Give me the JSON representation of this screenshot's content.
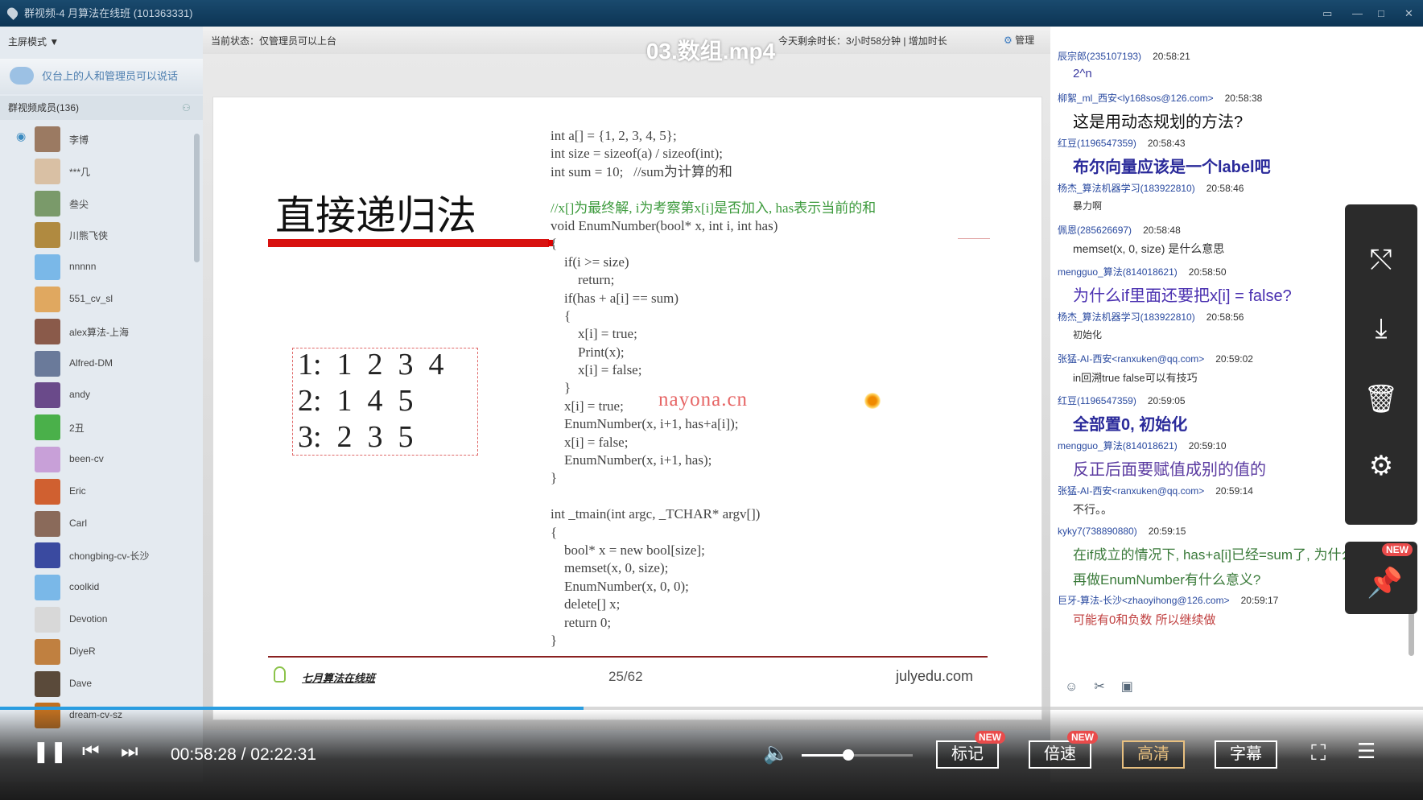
{
  "window": {
    "title": "群视频-4 月算法在线班 (101363331)",
    "controls": [
      "▭",
      "—",
      "□",
      "✕"
    ]
  },
  "sidebar": {
    "mode_label": "主屏模式 ▼",
    "tip": "仅台上的人和管理员可以说话",
    "members_header": "群视频成员(136)",
    "members": [
      {
        "name": "李博",
        "color": "#9b7a62"
      },
      {
        "name": "***几",
        "color": "#d9c0a4"
      },
      {
        "name": "叁尖",
        "color": "#7a9a6a"
      },
      {
        "name": "川熊飞侠",
        "color": "#b08a40"
      },
      {
        "name": "nnnnn",
        "color": "#7ab8e8"
      },
      {
        "name": "551_cv_sl",
        "color": "#e0a860"
      },
      {
        "name": "alex算法-上海",
        "color": "#8a5a4a"
      },
      {
        "name": "Alfred-DM",
        "color": "#6a7a9a"
      },
      {
        "name": "andy",
        "color": "#6a4a8a"
      },
      {
        "name": "2丑",
        "color": "#4ab04a"
      },
      {
        "name": "been-cv",
        "color": "#c8a0d8"
      },
      {
        "name": "Eric",
        "color": "#d06030"
      },
      {
        "name": "Carl",
        "color": "#8a6a5a"
      },
      {
        "name": "chongbing-cv-长沙",
        "color": "#3a4aa0"
      },
      {
        "name": "coolkid",
        "color": "#7ab8e8"
      },
      {
        "name": "Devotion",
        "color": "#d8d8d8"
      },
      {
        "name": "DiyeR",
        "color": "#c08040"
      },
      {
        "name": "Dave",
        "color": "#5a4a3a"
      },
      {
        "name": "dream-cv-sz",
        "color": "#c07020"
      }
    ]
  },
  "status_bar": {
    "left": "当前状态：仅管理员可以上台",
    "right": "今天剩余时长：3小时58分钟 | 增加时长",
    "manage": "管理"
  },
  "video": {
    "title": "03.数组.mp4",
    "current_time": "00:58:28",
    "total_time": "02:22:31",
    "progress_percent": 41,
    "volume_percent": 42,
    "buttons": {
      "mark": "标记",
      "speed": "倍速",
      "hd": "高清",
      "subtitle": "字幕",
      "new_badge": "NEW"
    },
    "accent": "#2a9de0",
    "hd_color": "#e8c080"
  },
  "slide": {
    "title": "直接递归法",
    "solutions": [
      "1:  1  2  3  4",
      "2:  1  4  5",
      "3:  2  3  5"
    ],
    "code": [
      {
        "t": "int a[] = {1, 2, 3, 4, 5};",
        "c": ""
      },
      {
        "t": "int size = sizeof(a) / sizeof(int);",
        "c": ""
      },
      {
        "t": "int sum = 10;   //sum为计算的和",
        "c": ""
      },
      {
        "t": "",
        "c": ""
      },
      {
        "t": "//x[]为最终解, i为考察第x[i]是否加入, has表示当前的和",
        "c": "cmt"
      },
      {
        "t": "void EnumNumber(bool* x, int i, int has)",
        "c": ""
      },
      {
        "t": "{",
        "c": ""
      },
      {
        "t": "    if(i >= size)",
        "c": ""
      },
      {
        "t": "        return;",
        "c": ""
      },
      {
        "t": "    if(has + a[i] == sum)",
        "c": ""
      },
      {
        "t": "    {",
        "c": ""
      },
      {
        "t": "        x[i] = true;",
        "c": ""
      },
      {
        "t": "        Print(x);",
        "c": ""
      },
      {
        "t": "        x[i] = false;",
        "c": ""
      },
      {
        "t": "    }",
        "c": ""
      },
      {
        "t": "    x[i] = true;",
        "c": ""
      },
      {
        "t": "    EnumNumber(x, i+1, has+a[i]);",
        "c": ""
      },
      {
        "t": "    x[i] = false;",
        "c": ""
      },
      {
        "t": "    EnumNumber(x, i+1, has);",
        "c": ""
      },
      {
        "t": "}",
        "c": ""
      },
      {
        "t": "",
        "c": ""
      },
      {
        "t": "int _tmain(int argc, _TCHAR* argv[])",
        "c": ""
      },
      {
        "t": "{",
        "c": ""
      },
      {
        "t": "    bool* x = new bool[size];",
        "c": ""
      },
      {
        "t": "    memset(x, 0, size);",
        "c": ""
      },
      {
        "t": "    EnumNumber(x, 0, 0);",
        "c": ""
      },
      {
        "t": "    delete[] x;",
        "c": ""
      },
      {
        "t": "    return 0;",
        "c": ""
      },
      {
        "t": "}",
        "c": ""
      }
    ],
    "footer_logo": "七月算法在线班",
    "page": "25/62",
    "site": "julyedu.com",
    "watermark": "nayona.cn"
  },
  "chat": {
    "messages": [
      {
        "sender": "辰宗郎(235107193)",
        "time": "20:58:21",
        "text": "2^n",
        "color": "#3a3aa0",
        "size": 15,
        "bold": false
      },
      {
        "sender": "柳絮_ml_西安<ly168sos@126.com>",
        "time": "20:58:38",
        "text": "这是用动态规划的方法?",
        "color": "#111",
        "size": 20,
        "bold": false
      },
      {
        "sender": "红豆(1196547359)",
        "time": "20:58:43",
        "text": "布尔向量应该是一个label吧",
        "color": "#2a2a9a",
        "size": 20,
        "bold": true
      },
      {
        "sender": "杨杰_算法机器学习(183922810)",
        "time": "20:58:46",
        "text": "暴力啊",
        "color": "#333",
        "size": 12,
        "bold": false
      },
      {
        "sender": "佩恩(285626697)",
        "time": "20:58:48",
        "text": "memset(x, 0, size) 是什么意思",
        "color": "#333",
        "size": 14,
        "bold": false
      },
      {
        "sender": "mengguo_算法(814018621)",
        "time": "20:58:50",
        "text": "为什么if里面还要把x[i] = false?",
        "color": "#4a30b0",
        "size": 20,
        "bold": false
      },
      {
        "sender": "杨杰_算法机器学习(183922810)",
        "time": "20:58:56",
        "text": "初始化",
        "color": "#333",
        "size": 12,
        "bold": false
      },
      {
        "sender": "张猛-AI-西安<ranxuken@qq.com>",
        "time": "20:59:02",
        "text": "in回溯true false可以有技巧",
        "color": "#333",
        "size": 13,
        "bold": false
      },
      {
        "sender": "红豆(1196547359)",
        "time": "20:59:05",
        "text": "全部置0, 初始化",
        "color": "#2a2a9a",
        "size": 20,
        "bold": true
      },
      {
        "sender": "mengguo_算法(814018621)",
        "time": "20:59:10",
        "text": "反正后面要赋值成别的值的",
        "color": "#5a3aa0",
        "size": 20,
        "bold": false
      },
      {
        "sender": "张猛-AI-西安<ranxuken@qq.com>",
        "time": "20:59:14",
        "text": "不行。。",
        "color": "#333",
        "size": 14,
        "bold": false
      },
      {
        "sender": "kyky7(738890880)",
        "time": "20:59:15",
        "text": "在if成立的情况下, has+a[i]已经=sum了, 为什么",
        "color": "#3a7a3a",
        "size": 17,
        "bold": false
      },
      {
        "sender": "",
        "time": "",
        "text": "再做EnumNumber有什么意义?",
        "color": "#3a7a3a",
        "size": 17,
        "bold": false
      },
      {
        "sender": "巨牙-算法-长沙<zhaoyihong@126.com>",
        "time": "20:59:17",
        "text": "可能有0和负数 所以继续做",
        "color": "#c04040",
        "size": 15,
        "bold": false
      }
    ]
  }
}
